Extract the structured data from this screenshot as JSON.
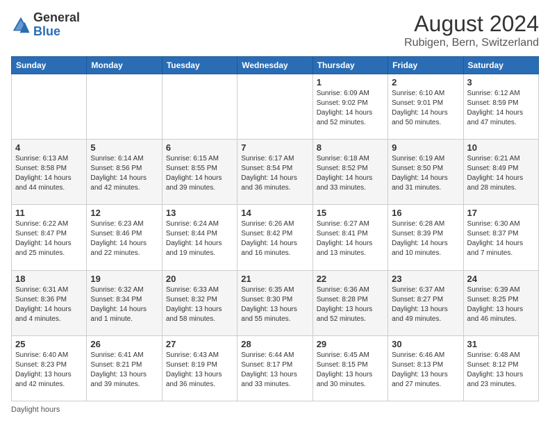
{
  "header": {
    "logo_general": "General",
    "logo_blue": "Blue",
    "main_title": "August 2024",
    "subtitle": "Rubigen, Bern, Switzerland"
  },
  "days_of_week": [
    "Sunday",
    "Monday",
    "Tuesday",
    "Wednesday",
    "Thursday",
    "Friday",
    "Saturday"
  ],
  "weeks": [
    [
      {
        "day": "",
        "info": ""
      },
      {
        "day": "",
        "info": ""
      },
      {
        "day": "",
        "info": ""
      },
      {
        "day": "",
        "info": ""
      },
      {
        "day": "1",
        "info": "Sunrise: 6:09 AM\nSunset: 9:02 PM\nDaylight: 14 hours\nand 52 minutes."
      },
      {
        "day": "2",
        "info": "Sunrise: 6:10 AM\nSunset: 9:01 PM\nDaylight: 14 hours\nand 50 minutes."
      },
      {
        "day": "3",
        "info": "Sunrise: 6:12 AM\nSunset: 8:59 PM\nDaylight: 14 hours\nand 47 minutes."
      }
    ],
    [
      {
        "day": "4",
        "info": "Sunrise: 6:13 AM\nSunset: 8:58 PM\nDaylight: 14 hours\nand 44 minutes."
      },
      {
        "day": "5",
        "info": "Sunrise: 6:14 AM\nSunset: 8:56 PM\nDaylight: 14 hours\nand 42 minutes."
      },
      {
        "day": "6",
        "info": "Sunrise: 6:15 AM\nSunset: 8:55 PM\nDaylight: 14 hours\nand 39 minutes."
      },
      {
        "day": "7",
        "info": "Sunrise: 6:17 AM\nSunset: 8:54 PM\nDaylight: 14 hours\nand 36 minutes."
      },
      {
        "day": "8",
        "info": "Sunrise: 6:18 AM\nSunset: 8:52 PM\nDaylight: 14 hours\nand 33 minutes."
      },
      {
        "day": "9",
        "info": "Sunrise: 6:19 AM\nSunset: 8:50 PM\nDaylight: 14 hours\nand 31 minutes."
      },
      {
        "day": "10",
        "info": "Sunrise: 6:21 AM\nSunset: 8:49 PM\nDaylight: 14 hours\nand 28 minutes."
      }
    ],
    [
      {
        "day": "11",
        "info": "Sunrise: 6:22 AM\nSunset: 8:47 PM\nDaylight: 14 hours\nand 25 minutes."
      },
      {
        "day": "12",
        "info": "Sunrise: 6:23 AM\nSunset: 8:46 PM\nDaylight: 14 hours\nand 22 minutes."
      },
      {
        "day": "13",
        "info": "Sunrise: 6:24 AM\nSunset: 8:44 PM\nDaylight: 14 hours\nand 19 minutes."
      },
      {
        "day": "14",
        "info": "Sunrise: 6:26 AM\nSunset: 8:42 PM\nDaylight: 14 hours\nand 16 minutes."
      },
      {
        "day": "15",
        "info": "Sunrise: 6:27 AM\nSunset: 8:41 PM\nDaylight: 14 hours\nand 13 minutes."
      },
      {
        "day": "16",
        "info": "Sunrise: 6:28 AM\nSunset: 8:39 PM\nDaylight: 14 hours\nand 10 minutes."
      },
      {
        "day": "17",
        "info": "Sunrise: 6:30 AM\nSunset: 8:37 PM\nDaylight: 14 hours\nand 7 minutes."
      }
    ],
    [
      {
        "day": "18",
        "info": "Sunrise: 6:31 AM\nSunset: 8:36 PM\nDaylight: 14 hours\nand 4 minutes."
      },
      {
        "day": "19",
        "info": "Sunrise: 6:32 AM\nSunset: 8:34 PM\nDaylight: 14 hours\nand 1 minute."
      },
      {
        "day": "20",
        "info": "Sunrise: 6:33 AM\nSunset: 8:32 PM\nDaylight: 13 hours\nand 58 minutes."
      },
      {
        "day": "21",
        "info": "Sunrise: 6:35 AM\nSunset: 8:30 PM\nDaylight: 13 hours\nand 55 minutes."
      },
      {
        "day": "22",
        "info": "Sunrise: 6:36 AM\nSunset: 8:28 PM\nDaylight: 13 hours\nand 52 minutes."
      },
      {
        "day": "23",
        "info": "Sunrise: 6:37 AM\nSunset: 8:27 PM\nDaylight: 13 hours\nand 49 minutes."
      },
      {
        "day": "24",
        "info": "Sunrise: 6:39 AM\nSunset: 8:25 PM\nDaylight: 13 hours\nand 46 minutes."
      }
    ],
    [
      {
        "day": "25",
        "info": "Sunrise: 6:40 AM\nSunset: 8:23 PM\nDaylight: 13 hours\nand 42 minutes."
      },
      {
        "day": "26",
        "info": "Sunrise: 6:41 AM\nSunset: 8:21 PM\nDaylight: 13 hours\nand 39 minutes."
      },
      {
        "day": "27",
        "info": "Sunrise: 6:43 AM\nSunset: 8:19 PM\nDaylight: 13 hours\nand 36 minutes."
      },
      {
        "day": "28",
        "info": "Sunrise: 6:44 AM\nSunset: 8:17 PM\nDaylight: 13 hours\nand 33 minutes."
      },
      {
        "day": "29",
        "info": "Sunrise: 6:45 AM\nSunset: 8:15 PM\nDaylight: 13 hours\nand 30 minutes."
      },
      {
        "day": "30",
        "info": "Sunrise: 6:46 AM\nSunset: 8:13 PM\nDaylight: 13 hours\nand 27 minutes."
      },
      {
        "day": "31",
        "info": "Sunrise: 6:48 AM\nSunset: 8:12 PM\nDaylight: 13 hours\nand 23 minutes."
      }
    ]
  ],
  "footer": {
    "note": "Daylight hours"
  }
}
